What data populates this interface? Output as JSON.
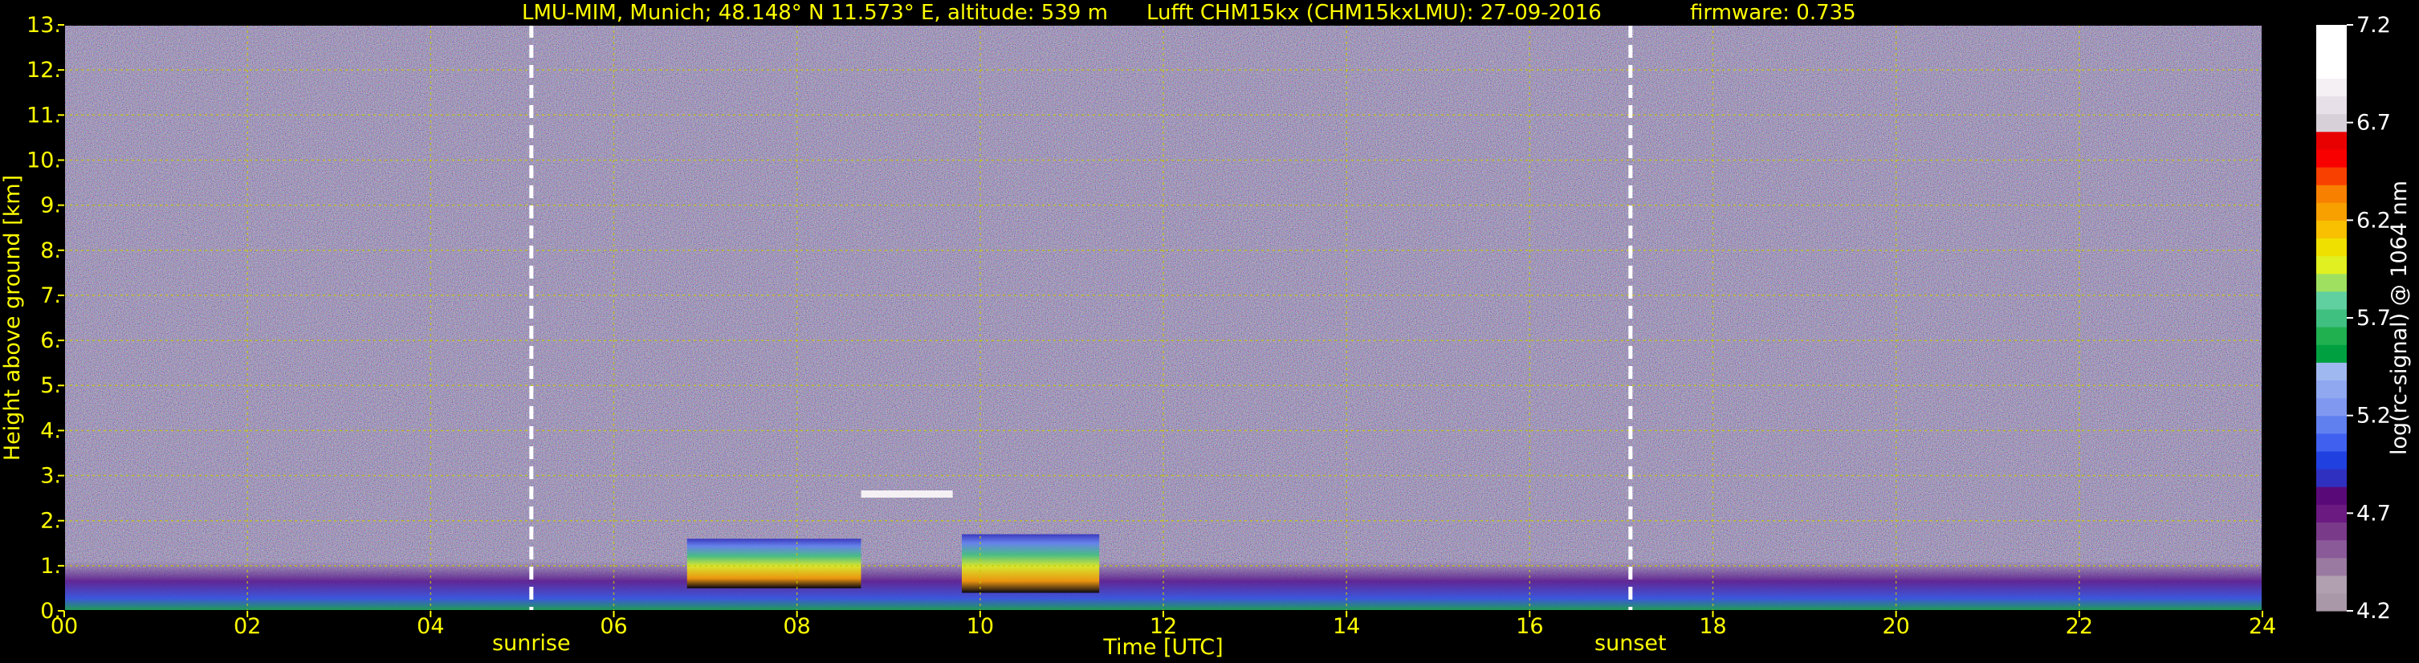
{
  "header": {
    "site": "LMU-MIM, Munich; 48.148° N 11.573° E, altitude: 539 m",
    "instrument": "Lufft CHM15kx (CHM15kxLMU): 27-09-2016",
    "firmware": "firmware: 0.735"
  },
  "colors": {
    "label_text": "#ffff00",
    "grid": "#c8c800",
    "marker_line": "#ffffff",
    "background": "#000000",
    "colorbar_text": "#ffffff"
  },
  "chart_data": {
    "type": "heatmap",
    "xlabel": "Time [UTC]",
    "ylabel": "Height above ground [km]",
    "xlim": [
      0,
      24
    ],
    "ylim": [
      0,
      13
    ],
    "x_ticks": [
      "00",
      "02",
      "04",
      "06",
      "08",
      "10",
      "12",
      "14",
      "16",
      "18",
      "20",
      "22",
      "24"
    ],
    "x_tick_values": [
      0,
      2,
      4,
      6,
      8,
      10,
      12,
      14,
      16,
      18,
      20,
      22,
      24
    ],
    "y_ticks": [
      "0.",
      "1.",
      "2.",
      "3.",
      "4.",
      "5.",
      "6.",
      "7.",
      "8.",
      "9.",
      "10.",
      "11.",
      "12.",
      "13."
    ],
    "y_tick_values": [
      0,
      1,
      2,
      3,
      4,
      5,
      6,
      7,
      8,
      9,
      10,
      11,
      12,
      13
    ],
    "grid": true,
    "markers": [
      {
        "label": "sunrise",
        "time": 5.1
      },
      {
        "label": "sunset",
        "time": 17.1
      }
    ],
    "features": [
      {
        "kind": "boundary_layer",
        "t_start": 0,
        "t_end": 24,
        "top_km": 1.1
      },
      {
        "kind": "aerosol_plume",
        "t_start": 6.8,
        "t_end": 8.7,
        "bottom_km": 0.5,
        "top_km": 1.6
      },
      {
        "kind": "aerosol_plume",
        "t_start": 9.8,
        "t_end": 11.3,
        "bottom_km": 0.4,
        "top_km": 1.7
      },
      {
        "kind": "cloud_layer",
        "t_start": 8.7,
        "t_end": 9.7,
        "height_km": 2.6
      }
    ],
    "colorbar": {
      "label": "log(rc-signal) @ 1064 nm",
      "min": 4.2,
      "max": 7.2,
      "ticks": [
        "7.2",
        "6.7",
        "6.2",
        "5.7",
        "5.2",
        "4.7",
        "4.2"
      ],
      "tick_values": [
        7.2,
        6.7,
        6.2,
        5.7,
        5.2,
        4.7,
        4.2
      ],
      "colors": [
        "#a898a8",
        "#b0a0b0",
        "#9a7aa0",
        "#8a5a98",
        "#7a3a8a",
        "#6a1a80",
        "#5a0a78",
        "#3030c0",
        "#2040e0",
        "#4060f0",
        "#6080f0",
        "#8098f0",
        "#90a8f0",
        "#a0b8f0",
        "#00a040",
        "#20b050",
        "#40c080",
        "#60d0a0",
        "#a0e060",
        "#e0f020",
        "#f0e000",
        "#f8c000",
        "#f8a000",
        "#f88000",
        "#f84000",
        "#f80000",
        "#e80000",
        "#d8d0d8",
        "#e8e0e8",
        "#f4f0f4",
        "#ffffff",
        "#ffffff",
        "#ffffff"
      ]
    }
  }
}
